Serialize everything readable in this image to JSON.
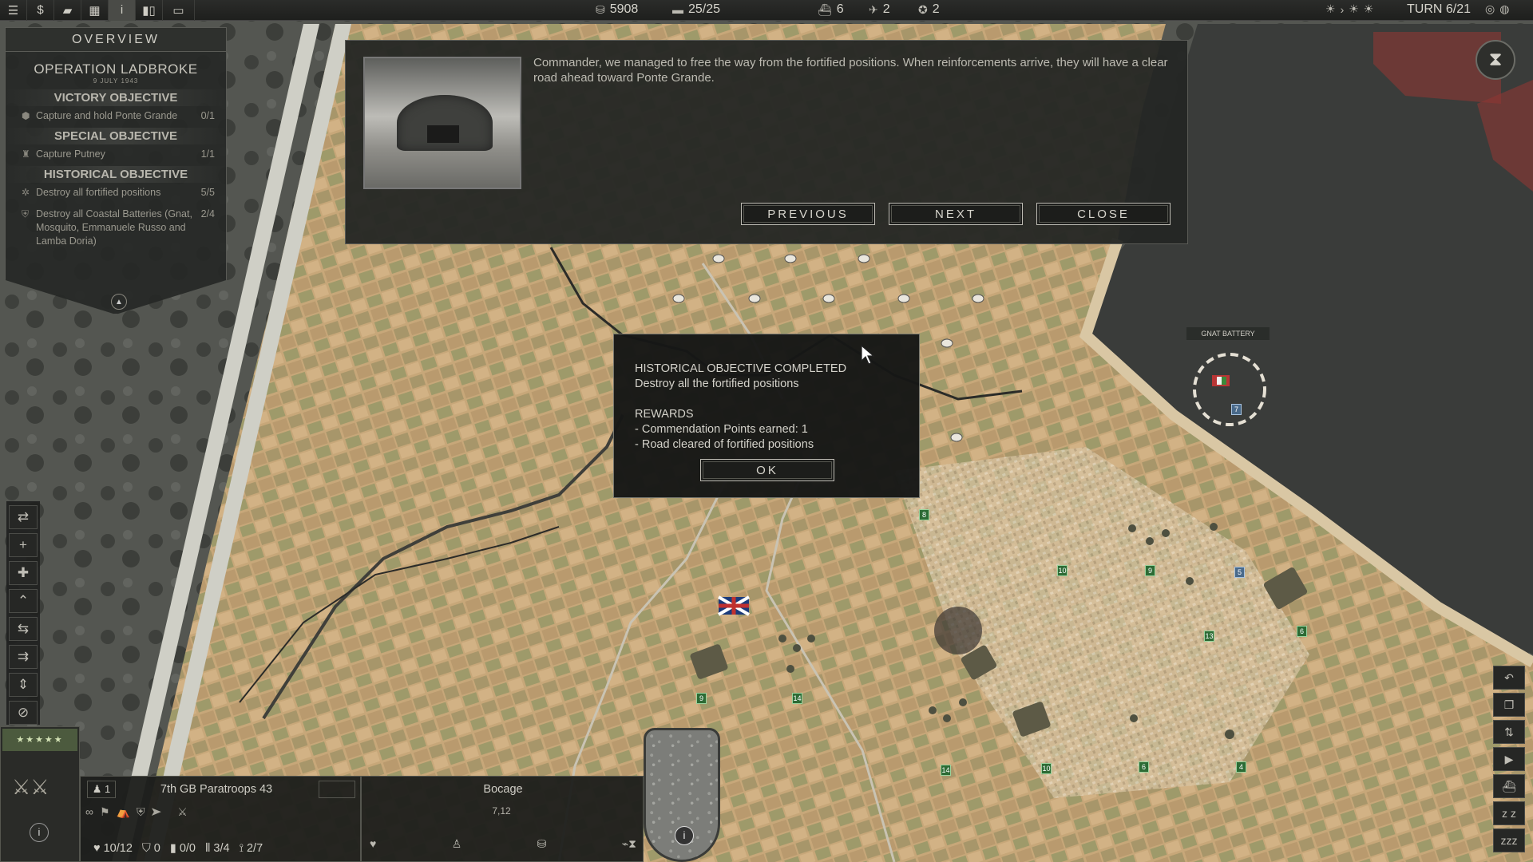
{
  "topbar": {
    "buttons": [
      "menu-icon",
      "money-icon",
      "chat-icon",
      "grid-icon",
      "info-icon",
      "chart-icon",
      "window-icon"
    ],
    "prestige": "5908",
    "core_slots": "25/25",
    "naval": "6",
    "air": "2",
    "generals": "2",
    "turn": "TURN 6/21"
  },
  "overview": {
    "header": "OVERVIEW",
    "operation": "OPERATION LADBROKE",
    "date": "9 JULY 1943",
    "victory_title": "VICTORY OBJECTIVE",
    "victory_item": "Capture and hold Ponte Grande",
    "victory_count": "0/1",
    "special_title": "SPECIAL OBJECTIVE",
    "special_item": "Capture Putney",
    "special_count": "1/1",
    "historical_title": "HISTORICAL OBJECTIVE",
    "hist_item1": "Destroy all fortified positions",
    "hist_count1": "5/5",
    "hist_item2": "Destroy all Coastal Batteries (Gnat, Mosquito, Emmanuele Russo and Lamba Doria)",
    "hist_count2": "2/4"
  },
  "message": {
    "text": "Commander, we managed to free the way from the fortified positions. When reinforcements arrive, they will have a clear road ahead toward Ponte Grande.",
    "previous": "PREVIOUS",
    "next": "NEXT",
    "close": "CLOSE"
  },
  "popup": {
    "line1": "HISTORICAL OBJECTIVE COMPLETED",
    "line2": "Destroy all the fortified positions",
    "line3": "REWARDS",
    "line4": "- Commendation Points earned: 1",
    "line5": "- Road cleared of fortified positions",
    "ok": "OK"
  },
  "map": {
    "gnat_label": "GNAT BATTERY",
    "markers": [
      "8",
      "10",
      "9",
      "5",
      "13",
      "6",
      "9",
      "14",
      "14",
      "10",
      "6",
      "4",
      "7"
    ]
  },
  "unit": {
    "count": "1",
    "name": "7th GB Paratroops 43",
    "health": "10/12",
    "kills": "0",
    "ammo": "0/0",
    "movement": "3/4",
    "fuel": "2/7"
  },
  "terrain": {
    "name": "Bocage",
    "coords": "7,12"
  },
  "colors": {
    "panel_bg": "#262826",
    "accent_green": "#2d6b35",
    "map_land": "#c9a97a",
    "sea": "#3b3d3b"
  }
}
